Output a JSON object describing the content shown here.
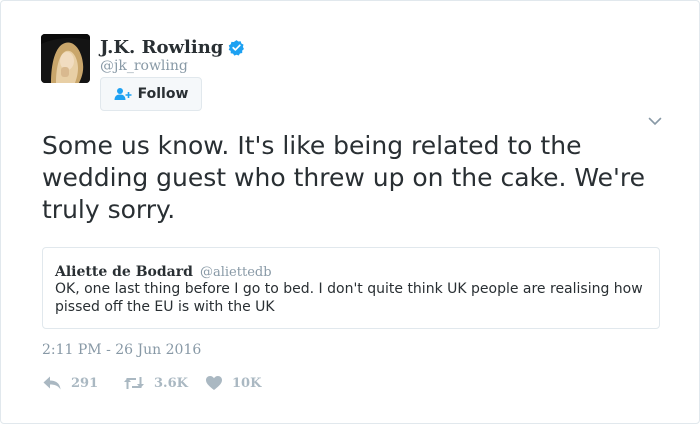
{
  "author": {
    "display_name": "J.K. Rowling",
    "handle": "@jk_rowling",
    "verified": true
  },
  "follow_button": {
    "label": "Follow"
  },
  "tweet": {
    "text": "Some us know. It's like being related to the wedding guest who threw up on the cake. We're truly sorry.",
    "timestamp": "2:11 PM - 26 Jun 2016"
  },
  "quoted_tweet": {
    "author_name": "Aliette de Bodard",
    "author_handle": "@aliettedb",
    "text": "OK, one last thing before I go to bed. I don't quite think UK people are realising how pissed off the EU is with the UK"
  },
  "actions": {
    "reply": {
      "icon": "reply-icon",
      "count": "291"
    },
    "retweet": {
      "icon": "retweet-icon",
      "count": "3.6K"
    },
    "like": {
      "icon": "heart-icon",
      "count": "10K"
    }
  },
  "colors": {
    "text": "#292f33",
    "muted": "#8899a6",
    "action_gray": "#aab8c2",
    "verified_blue": "#1da1f2",
    "border": "#e1e8ed",
    "follow_icon_blue": "#1da1f2"
  }
}
